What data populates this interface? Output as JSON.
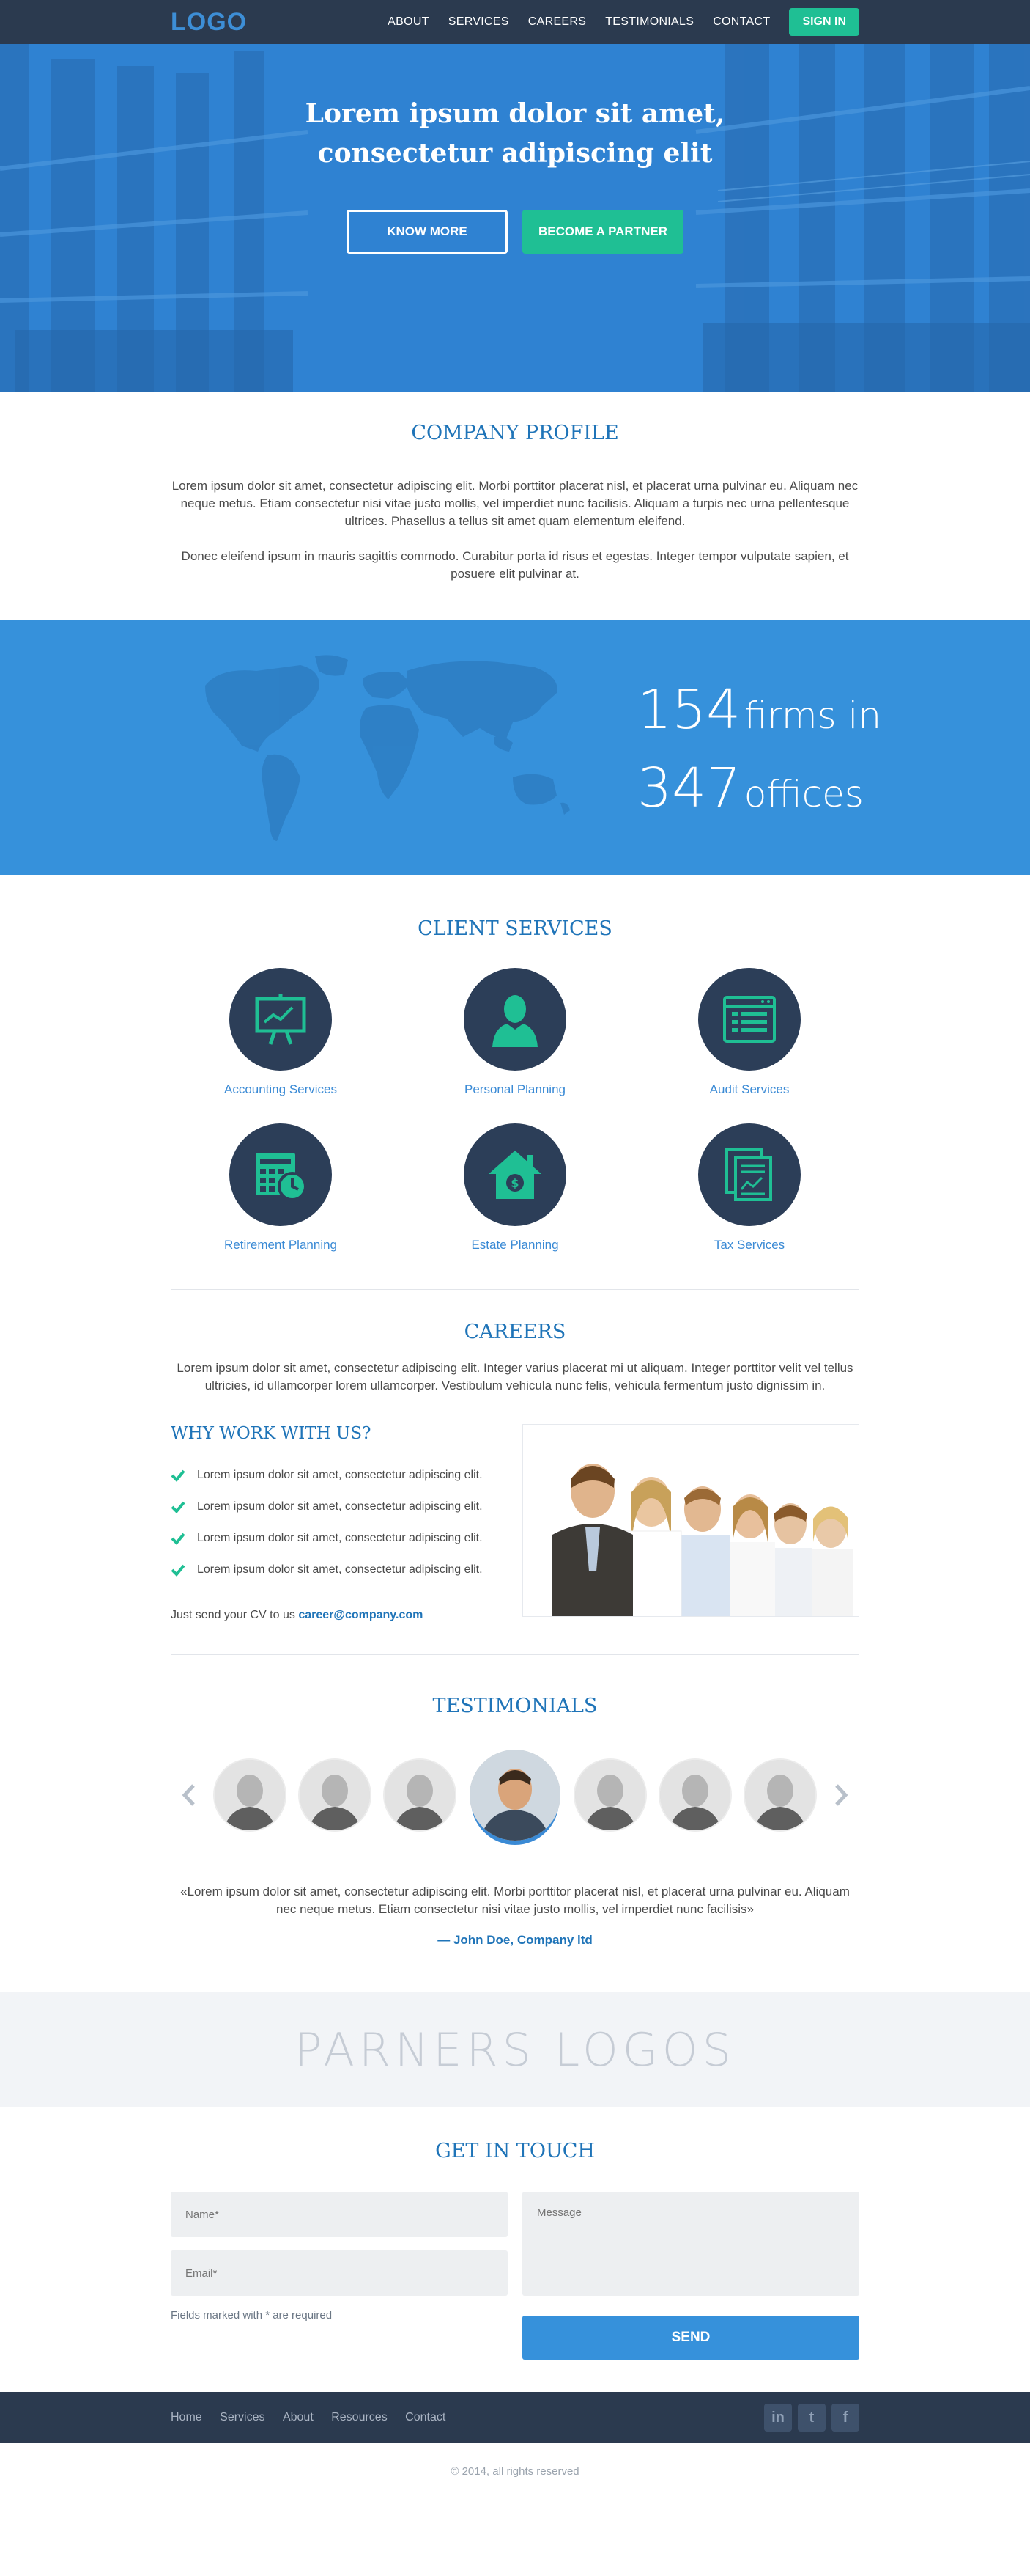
{
  "nav": {
    "logo": "LOGO",
    "items": [
      "ABOUT",
      "SERVICES",
      "CAREERS",
      "TESTIMONIALS",
      "CONTACT"
    ],
    "signin": "SIGN IN"
  },
  "hero": {
    "title_line1": "Lorem ipsum dolor sit amet,",
    "title_line2": "consectetur adipiscing elit",
    "btn_know_more": "KNOW MORE",
    "btn_partner": "BECOME A PARTNER"
  },
  "profile": {
    "title": "COMPANY PROFILE",
    "p1": "Lorem ipsum dolor sit amet, consectetur adipiscing elit. Morbi porttitor placerat nisl, et placerat urna pulvinar eu. Aliquam nec neque metus. Etiam consectetur nisi vitae justo mollis, vel imperdiet nunc facilisis. Aliquam a turpis nec urna pellentesque ultrices. Phasellus a tellus sit amet quam elementum eleifend.",
    "p2": "Donec eleifend ipsum in mauris sagittis commodo. Curabitur porta id risus et egestas. Integer tempor vulputate sapien, et posuere elit pulvinar at."
  },
  "stats": {
    "firms_number": "154",
    "firms_label": "firms in",
    "offices_number": "347",
    "offices_label": "offices"
  },
  "services": {
    "title": "CLIENT SERVICES",
    "items": [
      {
        "label": "Accounting Services",
        "icon": "presentation-board-icon"
      },
      {
        "label": "Personal Planning",
        "icon": "person-icon"
      },
      {
        "label": "Audit Services",
        "icon": "browser-list-icon"
      },
      {
        "label": "Retirement Planning",
        "icon": "calendar-clock-icon"
      },
      {
        "label": "Estate Planning",
        "icon": "house-dollar-icon"
      },
      {
        "label": "Tax Services",
        "icon": "documents-chart-icon"
      }
    ]
  },
  "careers": {
    "title": "CAREERS",
    "intro": "Lorem ipsum dolor sit amet, consectetur adipiscing elit. Integer varius placerat mi ut aliquam. Integer porttitor velit vel tellus ultricies, id ullamcorper lorem ullamcorper. Vestibulum vehicula nunc felis, vehicula fermentum justo dignissim in.",
    "why_title": "WHY WORK WITH US?",
    "bullets": [
      "Lorem ipsum dolor sit amet, consectetur adipiscing elit.",
      "Lorem ipsum dolor sit amet, consectetur adipiscing elit.",
      "Lorem ipsum dolor sit amet, consectetur adipiscing elit.",
      "Lorem ipsum dolor sit amet, consectetur adipiscing elit."
    ],
    "cv_text": "Just send your CV to us",
    "cv_email": "career@company.com"
  },
  "testimonials": {
    "title": "TESTIMONIALS",
    "quote": "«Lorem ipsum dolor sit amet, consectetur adipiscing elit. Morbi porttitor placerat nisl, et placerat urna pulvinar eu. Aliquam nec neque metus. Etiam consectetur nisi vitae justo mollis, vel imperdiet nunc facilisis»",
    "author": "— John Doe, Company ltd"
  },
  "partners": {
    "text": "PARNERS LOGOS"
  },
  "contact": {
    "title": "GET IN TOUCH",
    "name_placeholder": "Name*",
    "email_placeholder": "Email*",
    "message_placeholder": "Message",
    "required_note": "Fields marked with * are required",
    "send": "SEND"
  },
  "footer": {
    "links": [
      "Home",
      "Services",
      "About",
      "Resources",
      "Contact"
    ],
    "social": [
      "in",
      "t",
      "f"
    ],
    "copyright": "© 2014, all rights reserved"
  },
  "colors": {
    "navy": "#2b3a4f",
    "primary_blue": "#3691db",
    "heading_blue": "#1f74b8",
    "green": "#1fbf94"
  }
}
